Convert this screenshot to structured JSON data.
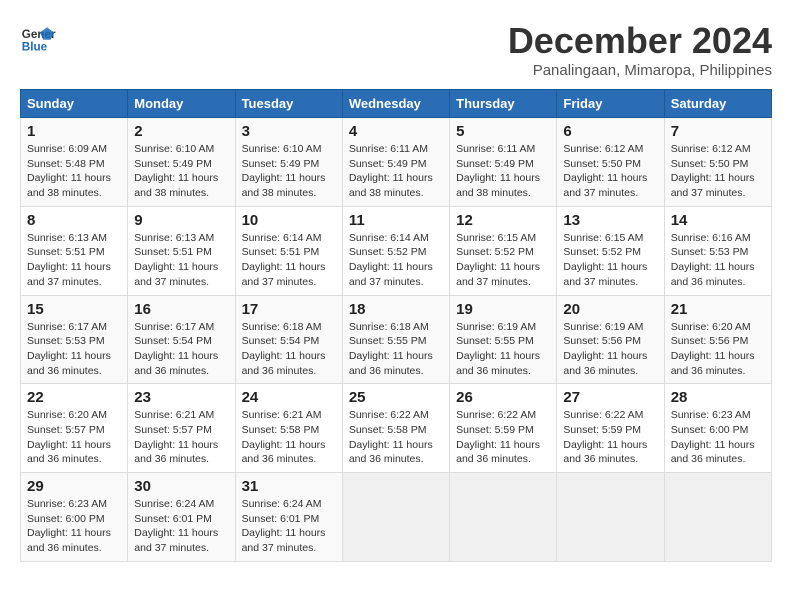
{
  "header": {
    "logo_line1": "General",
    "logo_line2": "Blue",
    "month": "December 2024",
    "location": "Panalingaan, Mimaropa, Philippines"
  },
  "columns": [
    "Sunday",
    "Monday",
    "Tuesday",
    "Wednesday",
    "Thursday",
    "Friday",
    "Saturday"
  ],
  "rows": [
    [
      {
        "day": "1",
        "info": "Sunrise: 6:09 AM\nSunset: 5:48 PM\nDaylight: 11 hours\nand 38 minutes."
      },
      {
        "day": "2",
        "info": "Sunrise: 6:10 AM\nSunset: 5:49 PM\nDaylight: 11 hours\nand 38 minutes."
      },
      {
        "day": "3",
        "info": "Sunrise: 6:10 AM\nSunset: 5:49 PM\nDaylight: 11 hours\nand 38 minutes."
      },
      {
        "day": "4",
        "info": "Sunrise: 6:11 AM\nSunset: 5:49 PM\nDaylight: 11 hours\nand 38 minutes."
      },
      {
        "day": "5",
        "info": "Sunrise: 6:11 AM\nSunset: 5:49 PM\nDaylight: 11 hours\nand 38 minutes."
      },
      {
        "day": "6",
        "info": "Sunrise: 6:12 AM\nSunset: 5:50 PM\nDaylight: 11 hours\nand 37 minutes."
      },
      {
        "day": "7",
        "info": "Sunrise: 6:12 AM\nSunset: 5:50 PM\nDaylight: 11 hours\nand 37 minutes."
      }
    ],
    [
      {
        "day": "8",
        "info": "Sunrise: 6:13 AM\nSunset: 5:51 PM\nDaylight: 11 hours\nand 37 minutes."
      },
      {
        "day": "9",
        "info": "Sunrise: 6:13 AM\nSunset: 5:51 PM\nDaylight: 11 hours\nand 37 minutes."
      },
      {
        "day": "10",
        "info": "Sunrise: 6:14 AM\nSunset: 5:51 PM\nDaylight: 11 hours\nand 37 minutes."
      },
      {
        "day": "11",
        "info": "Sunrise: 6:14 AM\nSunset: 5:52 PM\nDaylight: 11 hours\nand 37 minutes."
      },
      {
        "day": "12",
        "info": "Sunrise: 6:15 AM\nSunset: 5:52 PM\nDaylight: 11 hours\nand 37 minutes."
      },
      {
        "day": "13",
        "info": "Sunrise: 6:15 AM\nSunset: 5:52 PM\nDaylight: 11 hours\nand 37 minutes."
      },
      {
        "day": "14",
        "info": "Sunrise: 6:16 AM\nSunset: 5:53 PM\nDaylight: 11 hours\nand 36 minutes."
      }
    ],
    [
      {
        "day": "15",
        "info": "Sunrise: 6:17 AM\nSunset: 5:53 PM\nDaylight: 11 hours\nand 36 minutes."
      },
      {
        "day": "16",
        "info": "Sunrise: 6:17 AM\nSunset: 5:54 PM\nDaylight: 11 hours\nand 36 minutes."
      },
      {
        "day": "17",
        "info": "Sunrise: 6:18 AM\nSunset: 5:54 PM\nDaylight: 11 hours\nand 36 minutes."
      },
      {
        "day": "18",
        "info": "Sunrise: 6:18 AM\nSunset: 5:55 PM\nDaylight: 11 hours\nand 36 minutes."
      },
      {
        "day": "19",
        "info": "Sunrise: 6:19 AM\nSunset: 5:55 PM\nDaylight: 11 hours\nand 36 minutes."
      },
      {
        "day": "20",
        "info": "Sunrise: 6:19 AM\nSunset: 5:56 PM\nDaylight: 11 hours\nand 36 minutes."
      },
      {
        "day": "21",
        "info": "Sunrise: 6:20 AM\nSunset: 5:56 PM\nDaylight: 11 hours\nand 36 minutes."
      }
    ],
    [
      {
        "day": "22",
        "info": "Sunrise: 6:20 AM\nSunset: 5:57 PM\nDaylight: 11 hours\nand 36 minutes."
      },
      {
        "day": "23",
        "info": "Sunrise: 6:21 AM\nSunset: 5:57 PM\nDaylight: 11 hours\nand 36 minutes."
      },
      {
        "day": "24",
        "info": "Sunrise: 6:21 AM\nSunset: 5:58 PM\nDaylight: 11 hours\nand 36 minutes."
      },
      {
        "day": "25",
        "info": "Sunrise: 6:22 AM\nSunset: 5:58 PM\nDaylight: 11 hours\nand 36 minutes."
      },
      {
        "day": "26",
        "info": "Sunrise: 6:22 AM\nSunset: 5:59 PM\nDaylight: 11 hours\nand 36 minutes."
      },
      {
        "day": "27",
        "info": "Sunrise: 6:22 AM\nSunset: 5:59 PM\nDaylight: 11 hours\nand 36 minutes."
      },
      {
        "day": "28",
        "info": "Sunrise: 6:23 AM\nSunset: 6:00 PM\nDaylight: 11 hours\nand 36 minutes."
      }
    ],
    [
      {
        "day": "29",
        "info": "Sunrise: 6:23 AM\nSunset: 6:00 PM\nDaylight: 11 hours\nand 36 minutes."
      },
      {
        "day": "30",
        "info": "Sunrise: 6:24 AM\nSunset: 6:01 PM\nDaylight: 11 hours\nand 37 minutes."
      },
      {
        "day": "31",
        "info": "Sunrise: 6:24 AM\nSunset: 6:01 PM\nDaylight: 11 hours\nand 37 minutes."
      },
      {
        "day": "",
        "info": ""
      },
      {
        "day": "",
        "info": ""
      },
      {
        "day": "",
        "info": ""
      },
      {
        "day": "",
        "info": ""
      }
    ]
  ]
}
